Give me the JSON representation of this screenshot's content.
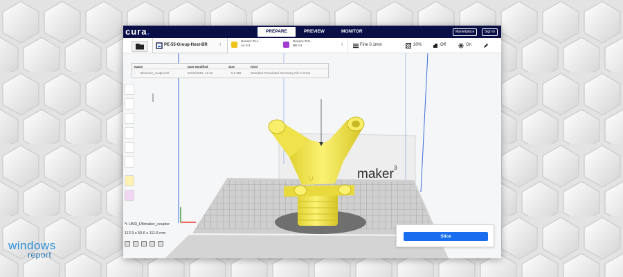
{
  "app": {
    "logo_text": "cura",
    "stages": [
      "PREPARE",
      "PREVIEW",
      "MONITOR"
    ],
    "active_stage": "PREPARE",
    "marketplace_label": "Marketplace",
    "signin_label": "Sign in"
  },
  "toolbar": {
    "machine_name": "PE-55-Group-Host-BR",
    "extruder1": {
      "material": "Generic PLA",
      "core": "AA 0.4",
      "color": "#f0c21c"
    },
    "extruder2": {
      "material": "Generic PVA",
      "core": "BB 0.4",
      "color": "#a23bd0"
    },
    "profile": "Fine 0.1mm",
    "infill": "20%",
    "support": "Off",
    "adhesion": "On"
  },
  "file_dialog": {
    "columns": [
      "Name",
      "Date Modified",
      "Size",
      "Kind"
    ],
    "rows": [
      {
        "name": "Ultimaker_coupler.stl",
        "date": "04/02/2018, 11:48",
        "size": "5.5 MB",
        "kind": "Standard Tesselated Geometry File Format"
      }
    ]
  },
  "viewport": {
    "printer_brand": "maker",
    "printer_superscript": "3",
    "model_color": "#f4ea5a"
  },
  "object": {
    "name": "UM3_Ultimaker_coupler",
    "dimensions": "112.9 x 50.6 x 111.6 mm"
  },
  "slice": {
    "button_label": "Slice"
  },
  "watermark": {
    "line1": "windows",
    "line2": "report"
  },
  "colors": {
    "topbar": "#0a0f47",
    "accent": "#196ef0"
  }
}
